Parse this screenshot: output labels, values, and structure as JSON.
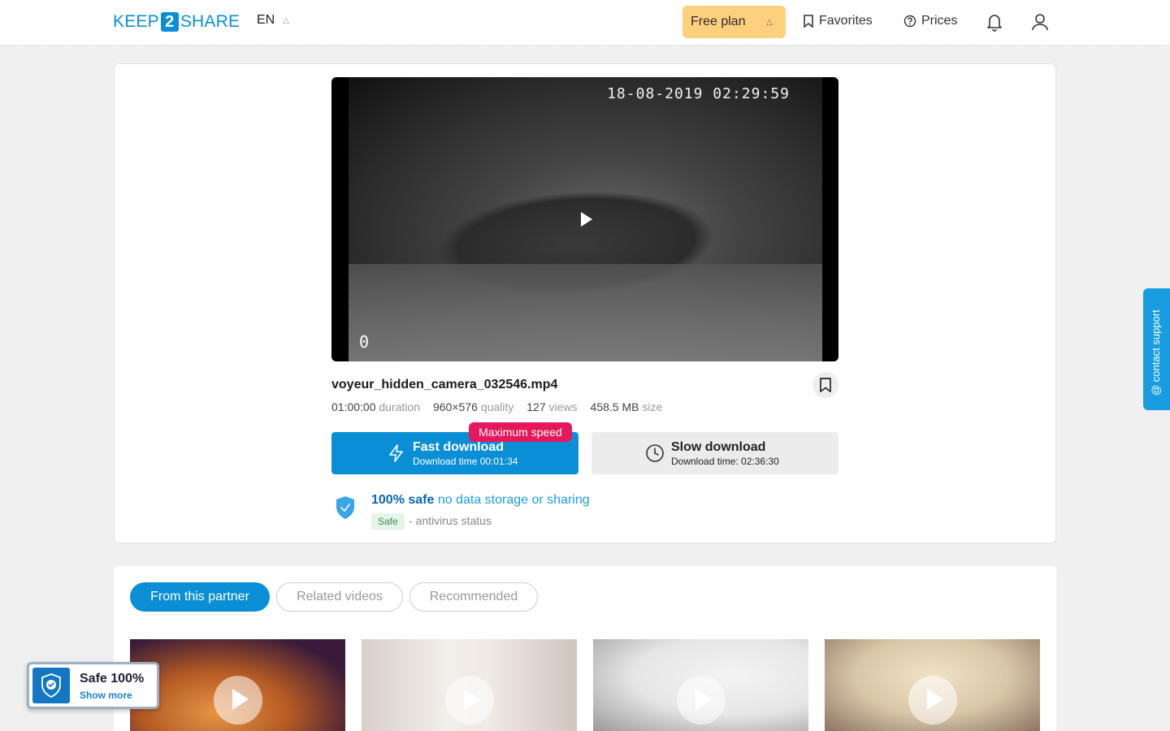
{
  "header": {
    "logo_left": "KEEP",
    "logo_mid": "2",
    "logo_right": "SHARE",
    "lang": "EN",
    "plan": "Free plan",
    "favorites": "Favorites",
    "prices": "Prices"
  },
  "video": {
    "timestamp": "18-08-2019  02:29:59",
    "counter": "0"
  },
  "file": {
    "name": "voyeur_hidden_camera_032546.mp4",
    "meta": [
      {
        "value": "01:00:00",
        "unit": "duration"
      },
      {
        "value": "960×576",
        "unit": "quality"
      },
      {
        "value": "127",
        "unit": "views"
      },
      {
        "value": "458.5 MB",
        "unit": "size"
      }
    ]
  },
  "download": {
    "badge": "Maximum speed",
    "fast_title": "Fast download",
    "fast_time": "Download time 00:01:34",
    "slow_title": "Slow download",
    "slow_time": "Download time: 02:36:30"
  },
  "safety": {
    "bold": "100% safe",
    "text": "no data storage or sharing",
    "tag": "Safe",
    "status": "- antivirus status"
  },
  "tabs": [
    "From this partner",
    "Related videos",
    "Recommended"
  ],
  "widget": {
    "title": "Safe 100%",
    "link": "Show more"
  },
  "support": "@ contact support",
  "colors": {
    "brand_blue": "#0a8fd6",
    "plan_yellow": "#fdd07e",
    "badge_red": "#e5185b"
  }
}
